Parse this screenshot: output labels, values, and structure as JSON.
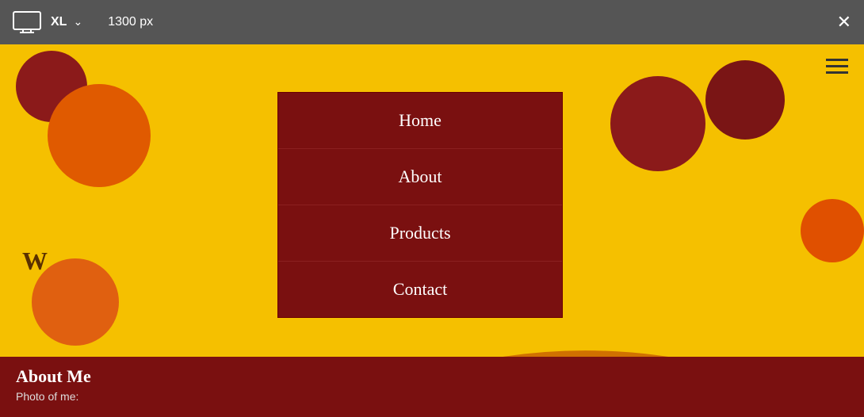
{
  "toolbar": {
    "device_label": "XL",
    "size_label": "1300 px",
    "close_label": "✕"
  },
  "menu": {
    "items": [
      {
        "label": "Home",
        "id": "home"
      },
      {
        "label": "About",
        "id": "about"
      },
      {
        "label": "Products",
        "id": "products"
      },
      {
        "label": "Contact",
        "id": "contact"
      }
    ]
  },
  "page": {
    "partial_title": "W",
    "about_me_title": "About Me",
    "photo_label": "Photo of me:"
  },
  "icons": {
    "monitor": "🖥",
    "hamburger_line": "─",
    "chevron": "∨"
  },
  "colors": {
    "background": "#F5C000",
    "menu_bg": "#7A1010",
    "toolbar_bg": "#555555",
    "bottom_bg": "#7A1010"
  }
}
